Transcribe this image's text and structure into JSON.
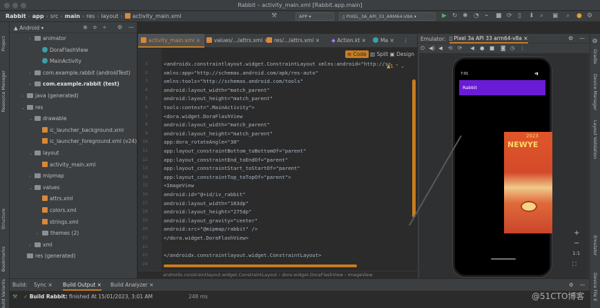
{
  "window": {
    "title": "Rabbit – activity_main.xml [Rabbit.app.main]"
  },
  "breadcrumb": [
    "Rabbit",
    "app",
    "src",
    "main",
    "res",
    "layout",
    "activity_main.xml"
  ],
  "toolbar": {
    "module": "APP",
    "device": "PIXEL_3A_API_33_ARM64-V8A"
  },
  "left_stripe": {
    "project": "Project",
    "resource_manager": "Resource Manager",
    "structure": "Structure",
    "bookmarks": "Bookmarks",
    "build_variants": "Build Variants"
  },
  "project_panel": {
    "view": "Android",
    "rows": [
      {
        "label": "animator",
        "kind": "folder",
        "indent": 2,
        "arrow": "›"
      },
      {
        "label": "DoraFlashView",
        "kind": "class",
        "indent": 3,
        "arrow": ""
      },
      {
        "label": "MainActivity",
        "kind": "class",
        "indent": 3,
        "arrow": ""
      },
      {
        "label": "com.example.rabbit (androidTest)",
        "kind": "folder",
        "indent": 2,
        "arrow": "›"
      },
      {
        "label": "com.example.rabbit (test)",
        "kind": "folder",
        "indent": 2,
        "arrow": "›",
        "selected": true
      },
      {
        "label": "java (generated)",
        "kind": "folder",
        "indent": 1,
        "arrow": "›"
      },
      {
        "label": "res",
        "kind": "folder",
        "indent": 1,
        "arrow": "⌄"
      },
      {
        "label": "drawable",
        "kind": "folder",
        "indent": 2,
        "arrow": "⌄"
      },
      {
        "label": "ic_launcher_background.xml",
        "kind": "xml",
        "indent": 3,
        "arrow": ""
      },
      {
        "label": "ic_launcher_foreground.xml (v24)",
        "kind": "xml",
        "indent": 3,
        "arrow": ""
      },
      {
        "label": "layout",
        "kind": "folder",
        "indent": 2,
        "arrow": "⌄"
      },
      {
        "label": "activity_main.xml",
        "kind": "xml",
        "indent": 3,
        "arrow": ""
      },
      {
        "label": "mipmap",
        "kind": "folder",
        "indent": 2,
        "arrow": "›"
      },
      {
        "label": "values",
        "kind": "folder",
        "indent": 2,
        "arrow": "⌄"
      },
      {
        "label": "attrs.xml",
        "kind": "xml",
        "indent": 3,
        "arrow": ""
      },
      {
        "label": "colors.xml",
        "kind": "xml",
        "indent": 3,
        "arrow": ""
      },
      {
        "label": "strings.xml",
        "kind": "xml",
        "indent": 3,
        "arrow": ""
      },
      {
        "label": "themes (2)",
        "kind": "folder",
        "indent": 3,
        "arrow": "›"
      },
      {
        "label": "xml",
        "kind": "folder",
        "indent": 2,
        "arrow": "›"
      },
      {
        "label": "res (generated)",
        "kind": "folder",
        "indent": 1,
        "arrow": ""
      }
    ]
  },
  "editor": {
    "tabs": [
      "activity_main.xml",
      "values/.../attrs.xml",
      "res/.../attrs.xml",
      "Action.kt",
      "Ma"
    ],
    "modes": {
      "code": "Code",
      "split": "Split",
      "design": "Design"
    },
    "line_numbers": [
      "1",
      "2",
      "3",
      "4",
      "5",
      "6",
      "7",
      "8",
      "9",
      "10",
      "11",
      "12",
      "13",
      "14",
      "15",
      "16",
      "17",
      "18",
      "19",
      "20",
      "21",
      "22",
      "23",
      "24"
    ],
    "code_lines": [
      "<androidx.constraintlayout.widget.ConstraintLayout xmlns:android=\"http://sc",
      "    xmlns:app=\"http://schemas.android.com/apk/res-auto\"",
      "    xmlns:tools=\"http://schemas.android.com/tools\"",
      "    android:layout_width=\"match_parent\"",
      "    android:layout_height=\"match_parent\"",
      "    tools:context=\".MainActivity\">",
      "    <dora.widget.DoraFlashView",
      "        android:layout_width=\"match_parent\"",
      "        android:layout_height=\"match_parent\"",
      "        app:dora_rotateAngle=\"30\"",
      "        app:layout_constraintBottom_toBottomOf=\"parent\"",
      "        app:layout_constraintEnd_toEndOf=\"parent\"",
      "        app:layout_constraintStart_toStartOf=\"parent\"",
      "        app:layout_constraintTop_toTopOf=\"parent\">",
      "        <ImageView",
      "            android:id=\"@+id/iv_rabbit\"",
      "            android:layout_width=\"183dp\"",
      "            android:layout_height=\"275dp\"",
      "            android:layout_gravity=\"center\"",
      "            android:src=\"@mipmap/rabbit\" />",
      "    </dora.widget.DoraFlashView>",
      "",
      "</androidx.constraintlayout.widget.ConstraintLayout>",
      ""
    ],
    "crumbs": [
      "androidx.constraintlayout.widget.ConstraintLayout",
      "dora.widget.DoraFlashView",
      "ImageView"
    ]
  },
  "emulator": {
    "label": "Emulator:",
    "device_tab": "Pixel 3a API 33 arm64-v8a",
    "app_title": "Rabbit",
    "status_time": "7:01",
    "poster_title": "NEWYE",
    "poster_year": "2023",
    "zoom_ratio": "1:1"
  },
  "right_stripe": {
    "gradle": "Gradle",
    "device_manager": "Device Manager",
    "layout_validation": "Layout Validation",
    "emulator": "Emulator",
    "device_file": "Device File E"
  },
  "build": {
    "label": "Build:",
    "tabs": [
      "Sync",
      "Build Output",
      "Build Analyzer"
    ],
    "active_tab": "Build Output",
    "message_bold": "Build Rabbit:",
    "message": "finished At 15/01/2023, 3:01 AM",
    "duration": "248 ms"
  },
  "watermark": "@51CTO博客"
}
